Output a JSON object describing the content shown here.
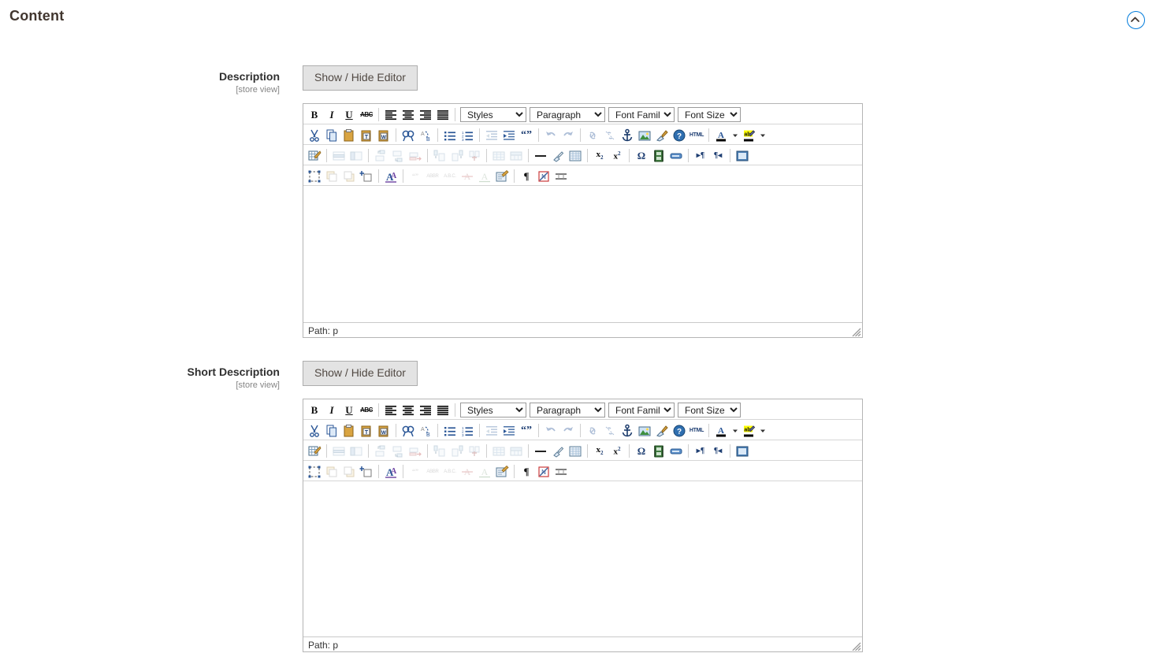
{
  "section": {
    "title": "Content",
    "collapse_icon": "chevron-up-circle-icon",
    "collapse_accent": "#007bdb"
  },
  "fields": [
    {
      "label": "Description",
      "scope": "[store view]",
      "button_label": "Show / Hide Editor",
      "editor": {
        "status_text": "Path: p",
        "selects": [
          {
            "name": "styles",
            "value": "Styles"
          },
          {
            "name": "paragraph",
            "value": "Paragraph"
          },
          {
            "name": "font-family",
            "value": "Font Family"
          },
          {
            "name": "font-size",
            "value": "Font Size"
          }
        ]
      }
    },
    {
      "label": "Short Description",
      "scope": "[store view]",
      "button_label": "Show / Hide Editor",
      "editor": {
        "status_text": "Path: p",
        "selects": [
          {
            "name": "styles",
            "value": "Styles"
          },
          {
            "name": "paragraph",
            "value": "Paragraph"
          },
          {
            "name": "font-family",
            "value": "Font Family"
          },
          {
            "name": "font-size",
            "value": "Font Size"
          }
        ]
      }
    }
  ],
  "toolbar": {
    "row1": [
      "bold-icon",
      "italic-icon",
      "underline-icon",
      "strikethrough-icon",
      "align-left-icon",
      "align-center-icon",
      "align-right-icon",
      "align-justify-icon"
    ],
    "row2": [
      "cut-icon",
      "copy-icon",
      "paste-icon",
      "paste-as-text-icon",
      "paste-from-word-icon",
      "find-icon",
      "find-replace-icon",
      "bullet-list-icon",
      "numbered-list-icon",
      "outdent-icon",
      "indent-icon",
      "blockquote-icon",
      "undo-icon",
      "redo-icon",
      "link-icon",
      "unlink-icon",
      "anchor-icon",
      "insert-image-icon",
      "cleanup-icon",
      "help-icon",
      "html-source-icon",
      "text-color-icon",
      "background-color-icon"
    ],
    "row3": [
      "insert-table-icon",
      "table-row-properties-icon",
      "table-cell-properties-icon",
      "insert-row-before-icon",
      "insert-row-after-icon",
      "delete-row-icon",
      "insert-column-before-icon",
      "insert-column-after-icon",
      "delete-column-icon",
      "split-cells-icon",
      "merge-cells-icon",
      "horizontal-rule-icon",
      "remove-format-icon",
      "toggle-guidelines-icon",
      "subscript-icon",
      "superscript-icon",
      "special-character-icon",
      "insert-media-icon",
      "insert-widget-icon",
      "ltr-icon",
      "rtl-icon",
      "fullscreen-icon"
    ],
    "row4": [
      "select-all-icon",
      "move-forward-icon",
      "move-backward-icon",
      "insert-layer-icon",
      "style-properties-icon",
      "citation-icon",
      "abbreviation-icon",
      "acronym-icon",
      "delete-text-icon",
      "insert-text-icon",
      "attributes-icon",
      "show-blocks-icon",
      "nonbreaking-icon",
      "page-break-icon"
    ],
    "colors": {
      "text_color_bar": "#000000",
      "highlight": "#ffff00",
      "icon_blue": "#2b5797",
      "icon_gold": "#e8a33d"
    }
  }
}
